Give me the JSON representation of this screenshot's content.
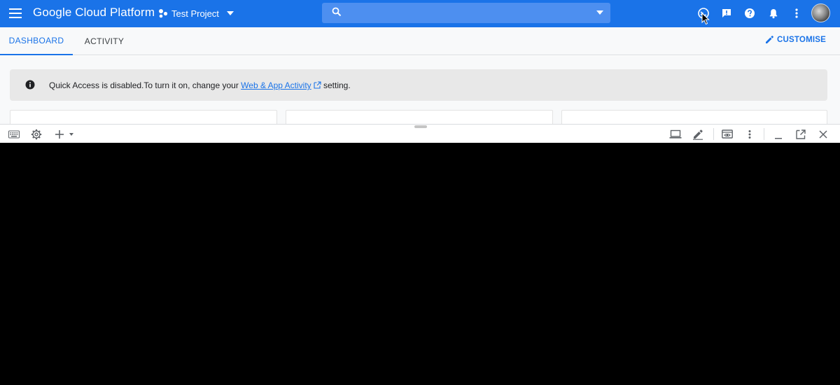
{
  "topbar": {
    "brand": "Google Cloud Platform",
    "project_name": "Test Project",
    "search": {
      "value": "",
      "placeholder": ""
    }
  },
  "tabs": [
    {
      "label": "DASHBOARD",
      "active": true
    },
    {
      "label": "ACTIVITY",
      "active": false
    }
  ],
  "customise_label": "CUSTOMISE",
  "notice": {
    "text_before": "Quick Access is disabled.To turn it on, change your ",
    "link_text": "Web & App Activity",
    "text_after": " setting."
  },
  "colors": {
    "primary": "#1a73e8",
    "search_bg": "#4d8ff0",
    "notice_bg": "#e8e8e8",
    "terminal_bg": "#000000"
  },
  "icons": {
    "topbar": [
      "menu-icon",
      "project-icon",
      "dropdown-icon",
      "search-icon",
      "cloud-shell-icon",
      "feedback-icon",
      "help-icon",
      "notifications-icon",
      "more-vert-icon"
    ],
    "shell_toolbar": [
      "keyboard-icon",
      "settings-icon",
      "add-icon",
      "web-preview-icon",
      "editor-icon",
      "boost-icon",
      "more-vert-icon",
      "minimize-icon",
      "open-new-window-icon",
      "close-icon"
    ]
  }
}
